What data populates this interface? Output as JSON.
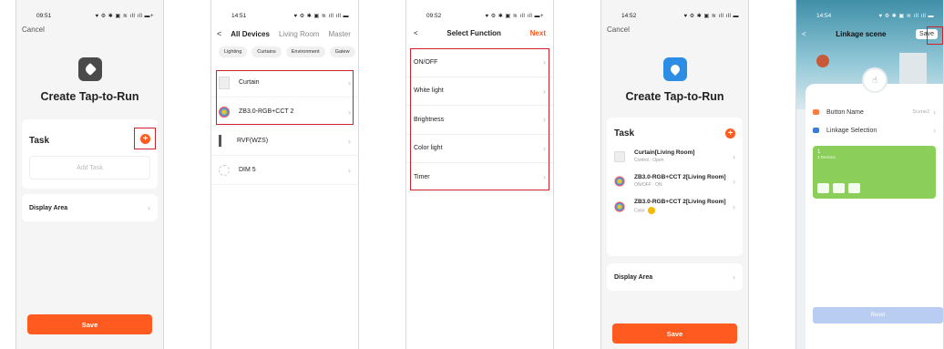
{
  "accent_color": "#ff5a1f",
  "highlight_color": "#d0202b",
  "screen1": {
    "time": "09:51",
    "status_icons": "♥ ⚙ ✱ ▣ ≋ ıll ıll ▬+",
    "cancel": "Cancel",
    "title": "Create Tap-to-Run",
    "task_label": "Task",
    "add_task": "Add Task",
    "display_area": "Display Area",
    "save": "Save"
  },
  "screen2": {
    "time": "14:51",
    "status_icons": "♥ ⚙ ✱ ▣ ≋ ıll ıll ▬",
    "back": "<",
    "tabs": [
      "All Devices",
      "Living Room",
      "Master"
    ],
    "chips": [
      "Lighting",
      "Curtains",
      "Environment",
      "Gatew"
    ],
    "devices": [
      "Curtain",
      "ZB3.0-RGB+CCT 2",
      "RVF(WZS)",
      "DIM 5"
    ]
  },
  "screen3": {
    "time": "09:52",
    "status_icons": "♥ ⚙ ✱ ▣ ≋ ıll ıll ▬+",
    "back": "<",
    "title": "Select Function",
    "next": "Next",
    "functions": [
      "ON/OFF",
      "White light",
      "Brightness",
      "Color light",
      "Timer"
    ]
  },
  "screen4": {
    "time": "14:52",
    "status_icons": "♥ ⚙ ✱ ▣ ≋ ıll ıll ▬",
    "cancel": "Cancel",
    "title": "Create Tap-to-Run",
    "task_label": "Task",
    "tasks": [
      {
        "name": "Curtain[Living Room]",
        "detail": "Control : Open"
      },
      {
        "name": "ZB3.0-RGB+CCT 2[Living Room]",
        "detail": "ON/OFF : ON"
      },
      {
        "name": "ZB3.0-RGB+CCT 2[Living Room]",
        "detail": "Color"
      }
    ],
    "display_area": "Display Area",
    "save": "Save"
  },
  "screen5": {
    "time": "14:54",
    "status_icons": "♥ ⚙ ✱ ▣ ≋ ıll ıll ▬",
    "back": "<",
    "title": "Linkage scene",
    "save": "Save",
    "button_name_label": "Button Name",
    "button_name_value": "Scene2",
    "linkage_selection": "Linkage Selection",
    "card_number": "1",
    "card_sub": "3 Devices",
    "reset": "Reset"
  }
}
